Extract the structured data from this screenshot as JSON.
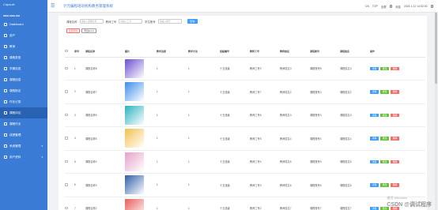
{
  "sidebar": {
    "brand": "Capsule",
    "brand_sub": "WEB ENGLISH",
    "items": [
      {
        "label": "Dashboard",
        "icon": "dashboard-icon"
      },
      {
        "label": "用户",
        "icon": "user-icon"
      },
      {
        "label": "教师",
        "icon": "teacher-icon"
      },
      {
        "label": "课程类型",
        "icon": "course-type-icon"
      },
      {
        "label": "学期信息",
        "icon": "semester-icon"
      },
      {
        "label": "课程信息",
        "icon": "course-info-icon"
      },
      {
        "label": "课程报名",
        "icon": "enroll-icon"
      },
      {
        "label": "作业记录",
        "icon": "homework-icon"
      },
      {
        "label": "课程评论",
        "icon": "comment-icon",
        "active": true
      },
      {
        "label": "课程作业",
        "icon": "assignment-icon"
      },
      {
        "label": "成绩管理",
        "icon": "grade-icon"
      },
      {
        "label": "系统管理",
        "icon": "system-icon",
        "chev": "▾"
      },
      {
        "label": "用户资料",
        "icon": "profile-icon",
        "chev": "▾"
      }
    ]
  },
  "topbar": {
    "title": "计元编程培训机构教务管理系统",
    "right_items": [
      "CN",
      "TOP",
      "全屏",
      "消息"
    ],
    "date": "2024-1-12 14:52:00"
  },
  "filters": {
    "name_label": "课程名称",
    "name_placeholder": "请输入课程名称",
    "teacher_label": "教师工号",
    "teacher_placeholder": "请输入工号",
    "student_label": "学生账号",
    "student_placeholder": "请输入账号",
    "search_label": "查询"
  },
  "actions": {
    "delete_label": "批量删除",
    "export_label": "导出Excel"
  },
  "table": {
    "headers": [
      "序号",
      "课程名称",
      "图片",
      "教学进度",
      "教学方法",
      "班级编号",
      "教师工号",
      "教师姓名",
      "课程账号",
      "课程姓名",
      "操作"
    ],
    "rows": [
      {
        "no": "1",
        "name": "课程名称8",
        "prog": "1",
        "method": "1",
        "cls": "十五班级",
        "tid": "教师工号2",
        "tname": "教师姓名3",
        "acc": "课程账号8",
        "cname": "课程姓名3"
      },
      {
        "no": "2",
        "name": "课程名称7",
        "prog": "1",
        "method": "1",
        "cls": "十五班级",
        "tid": "教师工号7",
        "tname": "教师姓名2",
        "acc": "课程账号2",
        "cname": "课程姓名2"
      },
      {
        "no": "3",
        "name": "课程名称6",
        "prog": "1",
        "method": "1",
        "cls": "十五班级",
        "tid": "教师工号6",
        "tname": "教师姓名3",
        "acc": "课程账号3",
        "cname": "课程姓名3"
      },
      {
        "no": "4",
        "name": "课程名称5",
        "prog": "1",
        "method": "1",
        "cls": "十五班级",
        "tid": "教师工号5",
        "tname": "教师姓名4",
        "acc": "课程账号4",
        "cname": "课程姓名4"
      },
      {
        "no": "5",
        "name": "课程名称4",
        "prog": "1",
        "method": "1",
        "cls": "十五班级",
        "tid": "教师工号4",
        "tname": "教师姓名5",
        "acc": "课程账号5",
        "cname": "课程姓名5"
      },
      {
        "no": "6",
        "name": "课程名称3",
        "prog": "1",
        "method": "1",
        "cls": "十五班级",
        "tid": "教师工号3",
        "tname": "教师姓名6",
        "acc": "课程账号6",
        "cname": "课程姓名6"
      },
      {
        "no": "7",
        "name": "课程名称2",
        "prog": "1",
        "method": "1",
        "cls": "十五班级",
        "tid": "教师工号2",
        "tname": "教师姓名7",
        "acc": "课程账号7",
        "cname": "课程姓名7"
      }
    ],
    "op_view": "详情",
    "op_edit": "修改",
    "op_del": "删除"
  },
  "watermark": {
    "line1": "激活 Windows",
    "line2": "CSDN @调试程序"
  },
  "colors": {
    "sidebar": "#3a7bd5",
    "primary": "#409eff",
    "success": "#67c23a",
    "danger": "#f56c6c"
  }
}
